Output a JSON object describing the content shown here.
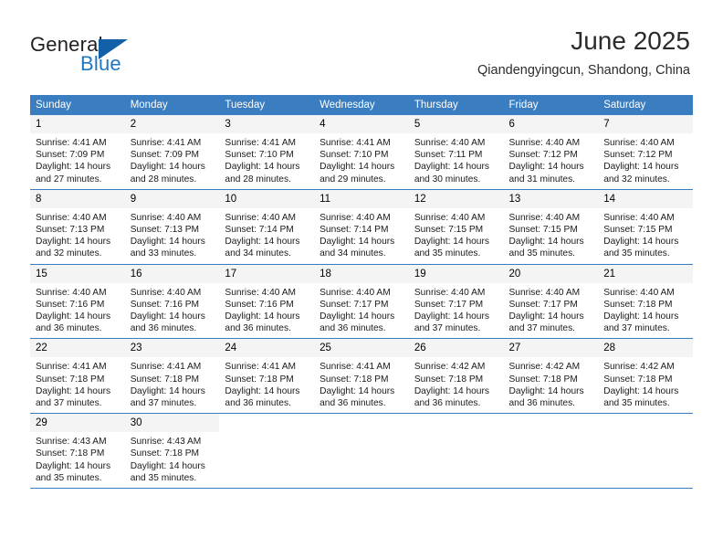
{
  "brand": {
    "name_top": "General",
    "name_bottom": "Blue",
    "triangle_color": "#1261a8",
    "text_color_top": "#231f20",
    "text_color_bottom": "#1f77c2"
  },
  "header": {
    "title": "June 2025",
    "subtitle": "Qiandengyingcun, Shandong, China"
  },
  "theme": {
    "header_bg": "#3a7dc0",
    "header_text": "#ffffff",
    "daynum_bg": "#f4f4f4",
    "row_divider": "#3a7dc0",
    "cell_bg": "#ffffff",
    "body_text": "#1a1a1a"
  },
  "weekdays": [
    "Sunday",
    "Monday",
    "Tuesday",
    "Wednesday",
    "Thursday",
    "Friday",
    "Saturday"
  ],
  "weeks": [
    [
      {
        "day": "1",
        "sunrise": "Sunrise: 4:41 AM",
        "sunset": "Sunset: 7:09 PM",
        "daylight": "Daylight: 14 hours and 27 minutes."
      },
      {
        "day": "2",
        "sunrise": "Sunrise: 4:41 AM",
        "sunset": "Sunset: 7:09 PM",
        "daylight": "Daylight: 14 hours and 28 minutes."
      },
      {
        "day": "3",
        "sunrise": "Sunrise: 4:41 AM",
        "sunset": "Sunset: 7:10 PM",
        "daylight": "Daylight: 14 hours and 28 minutes."
      },
      {
        "day": "4",
        "sunrise": "Sunrise: 4:41 AM",
        "sunset": "Sunset: 7:10 PM",
        "daylight": "Daylight: 14 hours and 29 minutes."
      },
      {
        "day": "5",
        "sunrise": "Sunrise: 4:40 AM",
        "sunset": "Sunset: 7:11 PM",
        "daylight": "Daylight: 14 hours and 30 minutes."
      },
      {
        "day": "6",
        "sunrise": "Sunrise: 4:40 AM",
        "sunset": "Sunset: 7:12 PM",
        "daylight": "Daylight: 14 hours and 31 minutes."
      },
      {
        "day": "7",
        "sunrise": "Sunrise: 4:40 AM",
        "sunset": "Sunset: 7:12 PM",
        "daylight": "Daylight: 14 hours and 32 minutes."
      }
    ],
    [
      {
        "day": "8",
        "sunrise": "Sunrise: 4:40 AM",
        "sunset": "Sunset: 7:13 PM",
        "daylight": "Daylight: 14 hours and 32 minutes."
      },
      {
        "day": "9",
        "sunrise": "Sunrise: 4:40 AM",
        "sunset": "Sunset: 7:13 PM",
        "daylight": "Daylight: 14 hours and 33 minutes."
      },
      {
        "day": "10",
        "sunrise": "Sunrise: 4:40 AM",
        "sunset": "Sunset: 7:14 PM",
        "daylight": "Daylight: 14 hours and 34 minutes."
      },
      {
        "day": "11",
        "sunrise": "Sunrise: 4:40 AM",
        "sunset": "Sunset: 7:14 PM",
        "daylight": "Daylight: 14 hours and 34 minutes."
      },
      {
        "day": "12",
        "sunrise": "Sunrise: 4:40 AM",
        "sunset": "Sunset: 7:15 PM",
        "daylight": "Daylight: 14 hours and 35 minutes."
      },
      {
        "day": "13",
        "sunrise": "Sunrise: 4:40 AM",
        "sunset": "Sunset: 7:15 PM",
        "daylight": "Daylight: 14 hours and 35 minutes."
      },
      {
        "day": "14",
        "sunrise": "Sunrise: 4:40 AM",
        "sunset": "Sunset: 7:15 PM",
        "daylight": "Daylight: 14 hours and 35 minutes."
      }
    ],
    [
      {
        "day": "15",
        "sunrise": "Sunrise: 4:40 AM",
        "sunset": "Sunset: 7:16 PM",
        "daylight": "Daylight: 14 hours and 36 minutes."
      },
      {
        "day": "16",
        "sunrise": "Sunrise: 4:40 AM",
        "sunset": "Sunset: 7:16 PM",
        "daylight": "Daylight: 14 hours and 36 minutes."
      },
      {
        "day": "17",
        "sunrise": "Sunrise: 4:40 AM",
        "sunset": "Sunset: 7:16 PM",
        "daylight": "Daylight: 14 hours and 36 minutes."
      },
      {
        "day": "18",
        "sunrise": "Sunrise: 4:40 AM",
        "sunset": "Sunset: 7:17 PM",
        "daylight": "Daylight: 14 hours and 36 minutes."
      },
      {
        "day": "19",
        "sunrise": "Sunrise: 4:40 AM",
        "sunset": "Sunset: 7:17 PM",
        "daylight": "Daylight: 14 hours and 37 minutes."
      },
      {
        "day": "20",
        "sunrise": "Sunrise: 4:40 AM",
        "sunset": "Sunset: 7:17 PM",
        "daylight": "Daylight: 14 hours and 37 minutes."
      },
      {
        "day": "21",
        "sunrise": "Sunrise: 4:40 AM",
        "sunset": "Sunset: 7:18 PM",
        "daylight": "Daylight: 14 hours and 37 minutes."
      }
    ],
    [
      {
        "day": "22",
        "sunrise": "Sunrise: 4:41 AM",
        "sunset": "Sunset: 7:18 PM",
        "daylight": "Daylight: 14 hours and 37 minutes."
      },
      {
        "day": "23",
        "sunrise": "Sunrise: 4:41 AM",
        "sunset": "Sunset: 7:18 PM",
        "daylight": "Daylight: 14 hours and 37 minutes."
      },
      {
        "day": "24",
        "sunrise": "Sunrise: 4:41 AM",
        "sunset": "Sunset: 7:18 PM",
        "daylight": "Daylight: 14 hours and 36 minutes."
      },
      {
        "day": "25",
        "sunrise": "Sunrise: 4:41 AM",
        "sunset": "Sunset: 7:18 PM",
        "daylight": "Daylight: 14 hours and 36 minutes."
      },
      {
        "day": "26",
        "sunrise": "Sunrise: 4:42 AM",
        "sunset": "Sunset: 7:18 PM",
        "daylight": "Daylight: 14 hours and 36 minutes."
      },
      {
        "day": "27",
        "sunrise": "Sunrise: 4:42 AM",
        "sunset": "Sunset: 7:18 PM",
        "daylight": "Daylight: 14 hours and 36 minutes."
      },
      {
        "day": "28",
        "sunrise": "Sunrise: 4:42 AM",
        "sunset": "Sunset: 7:18 PM",
        "daylight": "Daylight: 14 hours and 35 minutes."
      }
    ],
    [
      {
        "day": "29",
        "sunrise": "Sunrise: 4:43 AM",
        "sunset": "Sunset: 7:18 PM",
        "daylight": "Daylight: 14 hours and 35 minutes."
      },
      {
        "day": "30",
        "sunrise": "Sunrise: 4:43 AM",
        "sunset": "Sunset: 7:18 PM",
        "daylight": "Daylight: 14 hours and 35 minutes."
      },
      {
        "day": "",
        "sunrise": "",
        "sunset": "",
        "daylight": ""
      },
      {
        "day": "",
        "sunrise": "",
        "sunset": "",
        "daylight": ""
      },
      {
        "day": "",
        "sunrise": "",
        "sunset": "",
        "daylight": ""
      },
      {
        "day": "",
        "sunrise": "",
        "sunset": "",
        "daylight": ""
      },
      {
        "day": "",
        "sunrise": "",
        "sunset": "",
        "daylight": ""
      }
    ]
  ]
}
